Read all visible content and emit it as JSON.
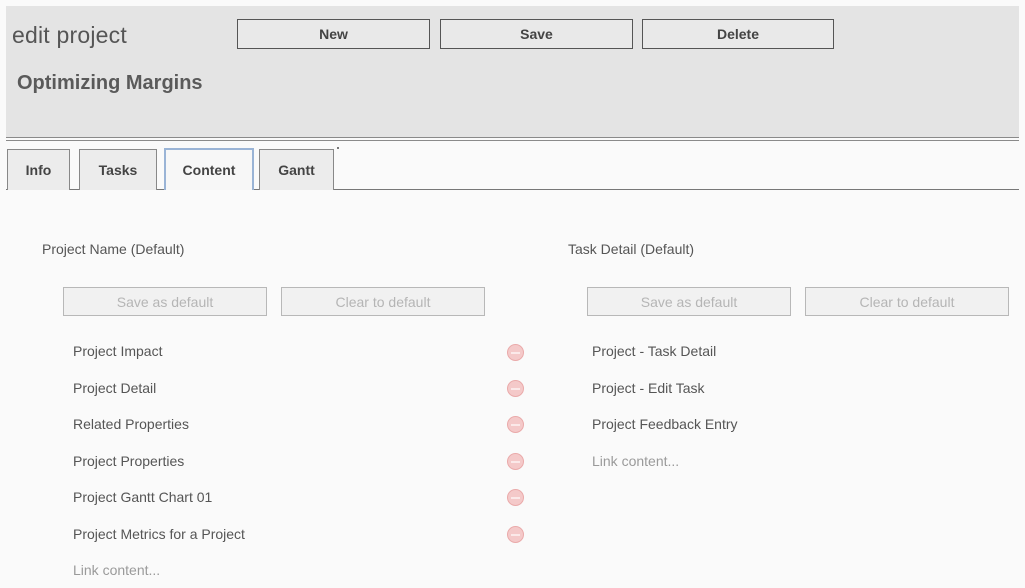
{
  "header": {
    "title": "edit project",
    "project_name": "Optimizing Margins",
    "buttons": {
      "new": "New",
      "save": "Save",
      "delete": "Delete"
    }
  },
  "tabs": [
    {
      "label": "Info",
      "active": false
    },
    {
      "label": "Tasks",
      "active": false
    },
    {
      "label": "Content",
      "active": true
    },
    {
      "label": "Gantt",
      "active": false
    }
  ],
  "content": {
    "left": {
      "label": "Project Name (Default)",
      "save_default": "Save as default",
      "clear_default": "Clear to default",
      "items": [
        "Project Impact",
        "Project Detail",
        "Related Properties",
        "Project Properties",
        "Project Gantt Chart 01",
        "Project Metrics for a Project"
      ],
      "link_content": "Link content..."
    },
    "right": {
      "label": "Task Detail (Default)",
      "save_default": "Save as default",
      "clear_default": "Clear to default",
      "items": [
        "Project - Task Detail",
        "Project - Edit Task",
        "Project Feedback Entry"
      ],
      "link_content": "Link content..."
    }
  },
  "colors": {
    "header_bg": "#e4e4e4",
    "active_tab_border": "#9ab4d6",
    "remove_icon": "#f4c9c9"
  },
  "icons": {
    "remove": "remove-icon"
  }
}
